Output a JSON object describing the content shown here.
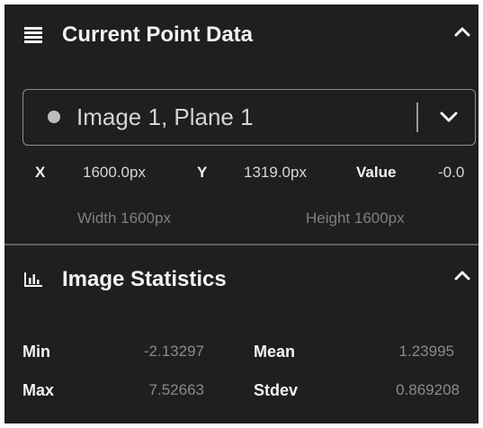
{
  "current_point": {
    "title": "Current Point Data",
    "header_icon": "list-icon",
    "collapse_icon": "chevron-up-icon",
    "layer_selector": {
      "selected": "Image 1, Plane 1",
      "dot_color": "#bdbdbd",
      "dropdown_icon": "chevron-down-icon"
    },
    "x_label": "X",
    "x_value": "1600.0px",
    "y_label": "Y",
    "y_value": "1319.0px",
    "value_label": "Value",
    "value_value": "-0.0",
    "width_text": "Width 1600px",
    "height_text": "Height 1600px"
  },
  "image_statistics": {
    "title": "Image Statistics",
    "header_icon": "bar-chart-icon",
    "collapse_icon": "chevron-up-icon",
    "min_label": "Min",
    "min_value": "-2.13297",
    "mean_label": "Mean",
    "mean_value": "1.23995",
    "max_label": "Max",
    "max_value": "7.52663",
    "stdev_label": "Stdev",
    "stdev_value": "0.869208"
  },
  "colors": {
    "panel_background": "#1e1f21",
    "text_primary": "#f2f2f2",
    "text_muted": "#8a8a8b",
    "border": "#8e8f91"
  }
}
